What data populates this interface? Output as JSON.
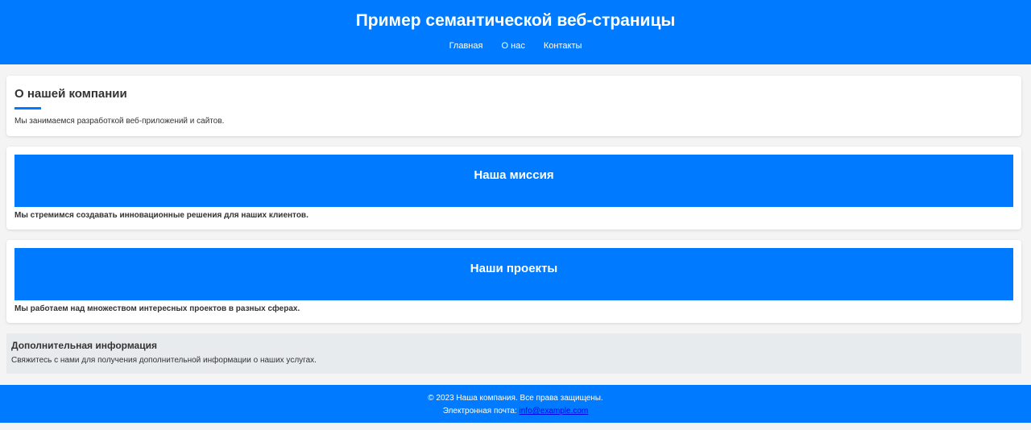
{
  "header": {
    "title": "Пример семантической веб-страницы",
    "nav": [
      {
        "label": "Главная"
      },
      {
        "label": "О нас"
      },
      {
        "label": "Контакты"
      }
    ]
  },
  "about": {
    "heading": "О нашей компании",
    "text": "Мы занимаемся разработкой веб-приложений и сайтов."
  },
  "mission": {
    "heading": "Наша миссия",
    "text": "Мы стремимся создавать инновационные решения для наших клиентов."
  },
  "projects": {
    "heading": "Наши проекты",
    "text": "Мы работаем над множеством интересных проектов в разных сферах."
  },
  "aside": {
    "heading": "Дополнительная информация",
    "text": "Свяжитесь с нами для получения дополнительной информации о наших услугах."
  },
  "footer": {
    "copyright": "© 2023 Наша компания. Все права защищены.",
    "email_label": "Электронная почта: ",
    "email": "info@example.com"
  },
  "colors": {
    "primary": "#007bff",
    "page_background": "#f4f4f4",
    "aside_background": "#e8ebee",
    "link": "#0000ee"
  }
}
